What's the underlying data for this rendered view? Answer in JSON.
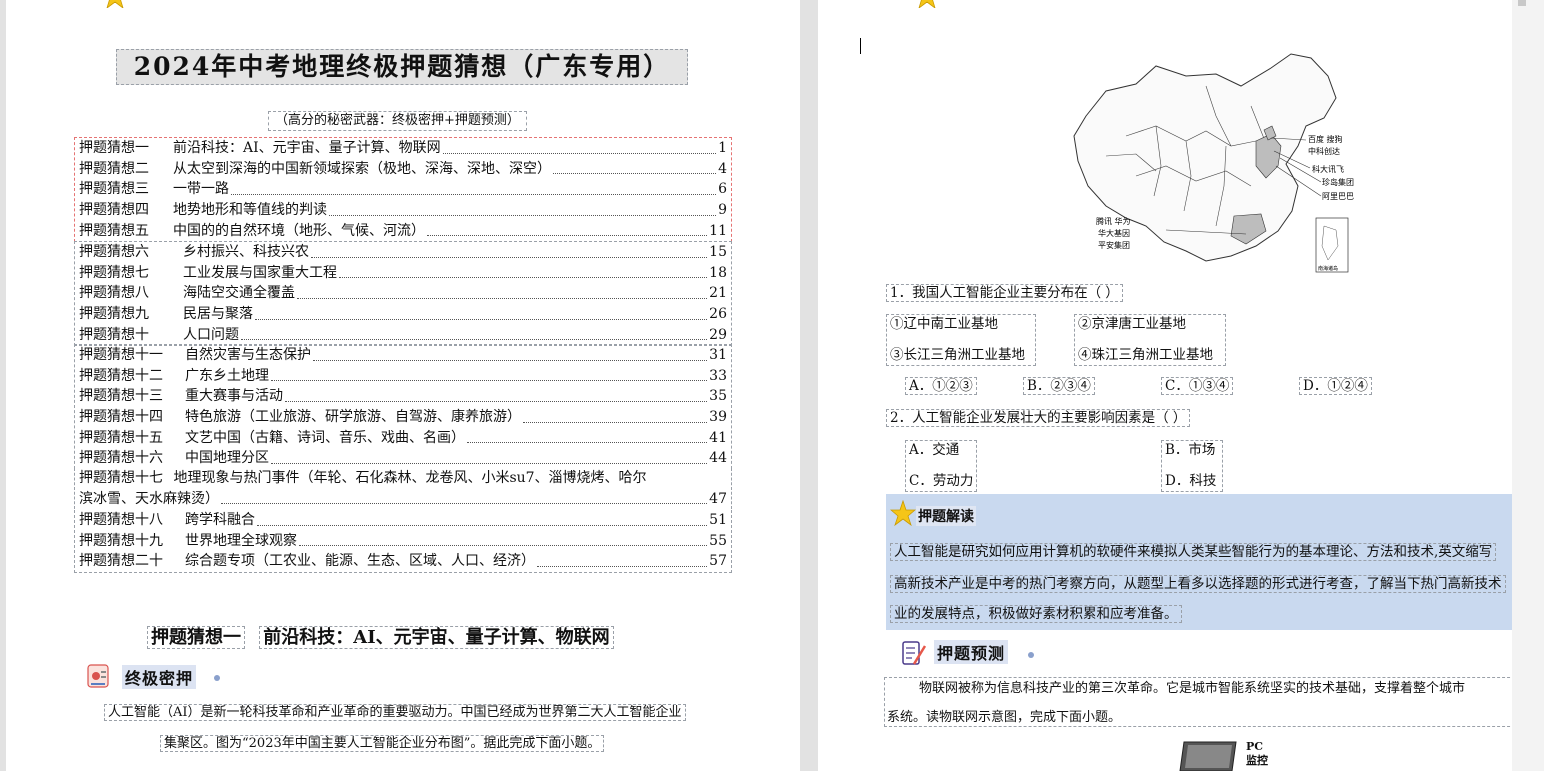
{
  "left_page": {
    "title": "2024年中考地理终极押题猜想（广东专用）",
    "subtitle": "（高分的秘密武器：终极密押+押题预测）",
    "toc_group1": [
      {
        "name": "押题猜想一",
        "topic": "前沿科技：AI、元宇宙、量子计算、物联网",
        "page": "1"
      },
      {
        "name": "押题猜想二",
        "topic": "从太空到深海的中国新领域探索（极地、深海、深地、深空）",
        "page": "4"
      },
      {
        "name": "押题猜想三",
        "topic": "一带一路",
        "page": "6"
      },
      {
        "name": "押题猜想四",
        "topic": "地势地形和等值线的判读",
        "page": "9"
      },
      {
        "name": "押题猜想五",
        "topic": "中国的的自然环境（地形、气候、河流）",
        "page": "11"
      }
    ],
    "toc_group2": [
      {
        "name": "押题猜想六",
        "topic": "乡村振兴、科技兴农",
        "page": "15"
      },
      {
        "name": "押题猜想七",
        "topic": "工业发展与国家重大工程",
        "page": "18"
      },
      {
        "name": "押题猜想八",
        "topic": "海陆空交通全覆盖",
        "page": "21"
      },
      {
        "name": "押题猜想九",
        "topic": "民居与聚落",
        "page": "26"
      },
      {
        "name": "押题猜想十",
        "topic": "人口问题",
        "page": "29"
      }
    ],
    "toc_group3": [
      {
        "name": "押题猜想十一",
        "topic": "自然灾害与生态保护",
        "page": "31"
      },
      {
        "name": "押题猜想十二",
        "topic": "广东乡土地理",
        "page": "33"
      },
      {
        "name": "押题猜想十三",
        "topic": "重大赛事与活动",
        "page": "35"
      },
      {
        "name": "押题猜想十四",
        "topic": "特色旅游（工业旅游、研学旅游、自驾游、康养旅游）",
        "page": "39"
      },
      {
        "name": "押题猜想十五",
        "topic": "文艺中国（古籍、诗词、音乐、戏曲、名画）",
        "page": "41"
      },
      {
        "name": "押题猜想十六",
        "topic": "中国地理分区",
        "page": "44"
      }
    ],
    "toc_wrap": {
      "name": "押题猜想十七",
      "topic_line1": "地理现象与热门事件（年轮、石化森林、龙卷风、小米su7、淄博烧烤、哈尔",
      "topic_line2": "滨冰雪、天水麻辣烫）",
      "page": "47"
    },
    "toc_group4": [
      {
        "name": "押题猜想十八",
        "topic": "跨学科融合",
        "page": "51"
      },
      {
        "name": "押题猜想十九",
        "topic": "世界地理全球观察",
        "page": "55"
      },
      {
        "name": "押题猜想二十",
        "topic": "综合题专项（工农业、能源、生态、区域、人口、经济）",
        "page": "57"
      }
    ],
    "section_label": "押题猜想一",
    "section_topic": "前沿科技：AI、元宇宙、量子计算、物联网",
    "tag_label": "终极密押",
    "intro_line1": "人工智能（AI）是新一轮科技革命和产业革命的重要驱动力。中国已经成为世界第二大人工智能企业",
    "intro_line2": "集聚区。图为“2023年中国主要人工智能企业分布图”。据此完成下面小题。"
  },
  "right_page": {
    "map_labels": {
      "beijing": "百度 搜狗",
      "beijing2": "中科创达",
      "hefei": "科大讯飞",
      "shanghai": "珍岛集团",
      "hangzhou": "阿里巴巴",
      "shenzhen1": "腾讯 华为",
      "shenzhen2": "华大基因",
      "shenzhen3": "平安集团",
      "inset": "南海诸岛"
    },
    "q1": {
      "stem": "1．我国人工智能企业主要分布在（    ）",
      "items": [
        "①辽中南工业基地",
        "②京津唐工业基地",
        "③长江三角洲工业基地",
        "④珠江三角洲工业基地"
      ],
      "options": [
        "A．①②③",
        "B．②③④",
        "C．①③④",
        "D．①②④"
      ]
    },
    "q2": {
      "stem": "2．人工智能企业发展壮大的主要影响因素是（    ）",
      "options": [
        "A．交通",
        "B．市场",
        "C．劳动力",
        "D．科技"
      ]
    },
    "analysis_label": "押题解读",
    "analysis_lines": [
      "人工智能是研究如何应用计算机的软硬件来模拟人类某些智能行为的基本理论、方法和技术,英文缩写",
      "高新技术产业是中考的热门考察方向，从题型上看多以选择题的形式进行考查，了解当下热门高新技术",
      "业的发展特点，积极做好素材积累和应考准备。"
    ],
    "predict_label": "押题预测",
    "predict_line1": "物联网被称为信息科技产业的第三次革命。它是城市智能系统坚实的技术基础，支撑着整个城市",
    "predict_line2": "系统。读物联网示意图，完成下面小题。",
    "device_label1": "PC",
    "device_label2": "监控"
  },
  "colors": {
    "analysis_bg": "#c9d9ef",
    "tag_bg": "#dce3f2",
    "toc_group1_border": "#e57373",
    "star": "#f5c518"
  }
}
